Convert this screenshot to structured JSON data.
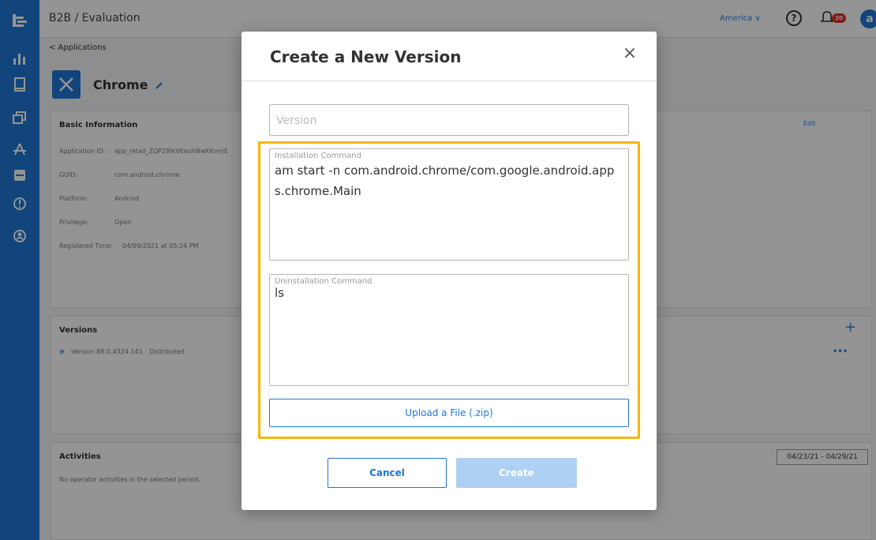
{
  "topbar": {
    "breadcrumb": "B2B / Evaluation",
    "region": "America ∨",
    "help_glyph": "?",
    "notification_count": "20",
    "brand_glyph": "a"
  },
  "page": {
    "back_link": "< Applications",
    "app_name": "Chrome",
    "basic_info": {
      "title": "Basic Information",
      "edit": "Edit",
      "rows": [
        {
          "label": "Application ID:",
          "value": "app_retail_ZQP28lkVEeuhNwKKmrjE"
        },
        {
          "label": "GUID:",
          "value": "com.android.chrome"
        },
        {
          "label": "Platform:",
          "value": "Android"
        },
        {
          "label": "Privilege:",
          "value": "Open"
        },
        {
          "label": "Registered Time:",
          "value": "04/09/2021 at 05:24 PM"
        }
      ]
    },
    "versions": {
      "title": "Versions",
      "add": "+",
      "item": "Version 88.0.4324.141",
      "item_status": "Distributed",
      "more": "•••"
    },
    "activities": {
      "title": "Activities",
      "empty": "No operator activities in the selected period.",
      "date_range": "04/23/21 - 04/29/21"
    }
  },
  "modal": {
    "title": "Create a New Version",
    "close": "×",
    "version_placeholder": "Version",
    "install_label": "Installation Command",
    "install_value": "am start -n com.android.chrome/com.google.android.apps.chrome.Main",
    "uninstall_label": "Uninstallation Command",
    "uninstall_value": "ls",
    "upload": "Upload a File (.zip)",
    "cancel": "Cancel",
    "create": "Create"
  },
  "colors": {
    "accent": "#1e78d6",
    "highlight": "#f5b700",
    "badge": "#e32d2d"
  },
  "icons": [
    "app-logo-icon",
    "analytics-icon",
    "device-icon",
    "gallery-icon",
    "app-store-icon",
    "inbox-icon",
    "alert-icon",
    "user-icon",
    "edit-pencil-icon",
    "app-icon"
  ]
}
